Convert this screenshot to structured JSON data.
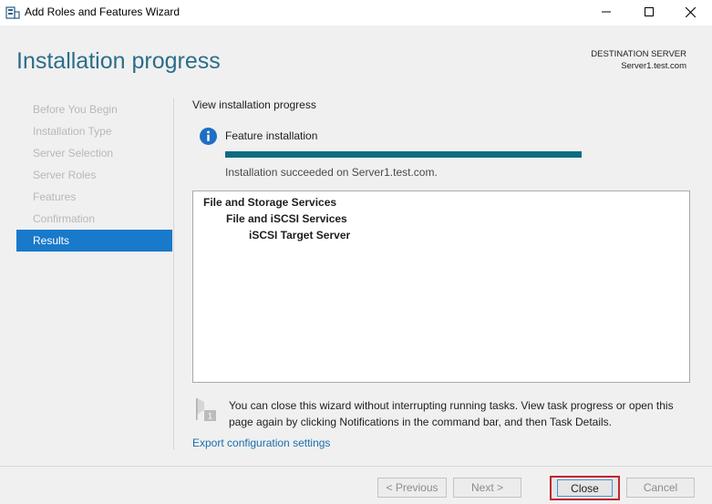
{
  "window": {
    "title": "Add Roles and Features Wizard",
    "icon": "server-manager-icon"
  },
  "header": {
    "page_title": "Installation progress",
    "destination_label": "DESTINATION SERVER",
    "destination_server": "Server1.test.com"
  },
  "nav": {
    "items": [
      {
        "label": "Before You Begin",
        "state": "disabled"
      },
      {
        "label": "Installation Type",
        "state": "disabled"
      },
      {
        "label": "Server Selection",
        "state": "disabled"
      },
      {
        "label": "Server Roles",
        "state": "disabled"
      },
      {
        "label": "Features",
        "state": "disabled"
      },
      {
        "label": "Confirmation",
        "state": "disabled"
      },
      {
        "label": "Results",
        "state": "active"
      }
    ]
  },
  "main": {
    "section_title": "View installation progress",
    "feature_label": "Feature installation",
    "progress": 1.0,
    "progress_color": "#0e6c80",
    "status_text": "Installation succeeded on Server1.test.com.",
    "results": [
      "File and Storage Services",
      "File and iSCSI Services",
      "iSCSI Target Server"
    ],
    "note": "You can close this wizard without interrupting running tasks. View task progress or open this page again by clicking Notifications in the command bar, and then Task Details.",
    "export_link": "Export configuration settings"
  },
  "footer": {
    "previous": "< Previous",
    "next": "Next >",
    "close": "Close",
    "cancel": "Cancel"
  },
  "colors": {
    "accent": "#1979ca",
    "title": "#2b6e8a",
    "highlight_border": "#c0272d"
  }
}
